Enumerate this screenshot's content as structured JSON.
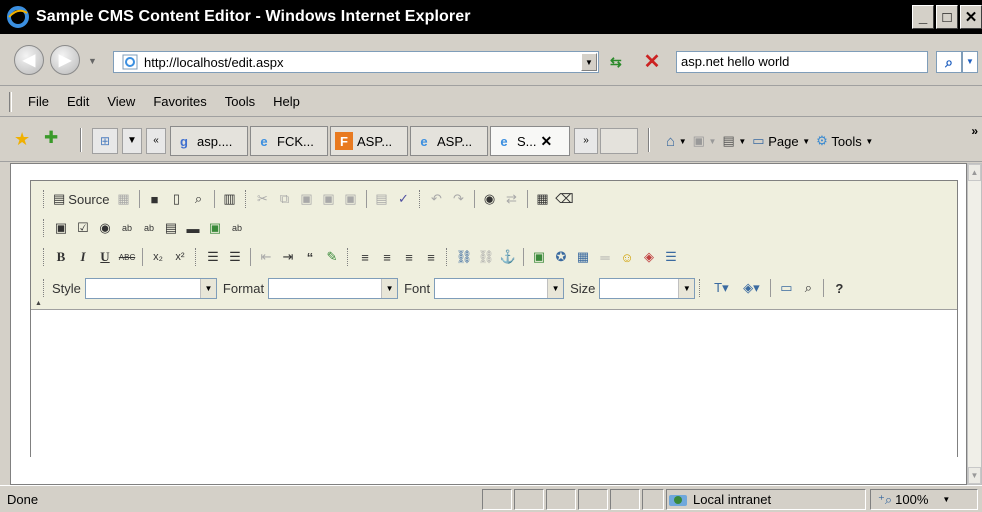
{
  "window": {
    "title": "Sample CMS Content Editor - Windows Internet Explorer"
  },
  "address": {
    "url": "http://localhost/edit.aspx",
    "search_value": "asp.net hello world"
  },
  "menu": [
    "File",
    "Edit",
    "View",
    "Favorites",
    "Tools",
    "Help"
  ],
  "tabs": [
    {
      "label": "asp....",
      "icon": "google-icon"
    },
    {
      "label": "FCK...",
      "icon": "ie-icon"
    },
    {
      "label": "ASP...",
      "icon": "fck-icon"
    },
    {
      "label": "ASP...",
      "icon": "ie-icon"
    },
    {
      "label": "S...",
      "icon": "ie-icon",
      "active": true
    }
  ],
  "command_bar": {
    "page_label": "Page",
    "tools_label": "Tools"
  },
  "editor": {
    "source_label": "Source",
    "style_label": "Style",
    "format_label": "Format",
    "font_label": "Font",
    "size_label": "Size"
  },
  "status": {
    "text": "Done",
    "zone": "Local intranet",
    "zoom": "100%"
  },
  "colors": {
    "titlebar": "#000000",
    "toolbar_bg": "#efefde",
    "chrome_bg": "#d4d0c8"
  }
}
